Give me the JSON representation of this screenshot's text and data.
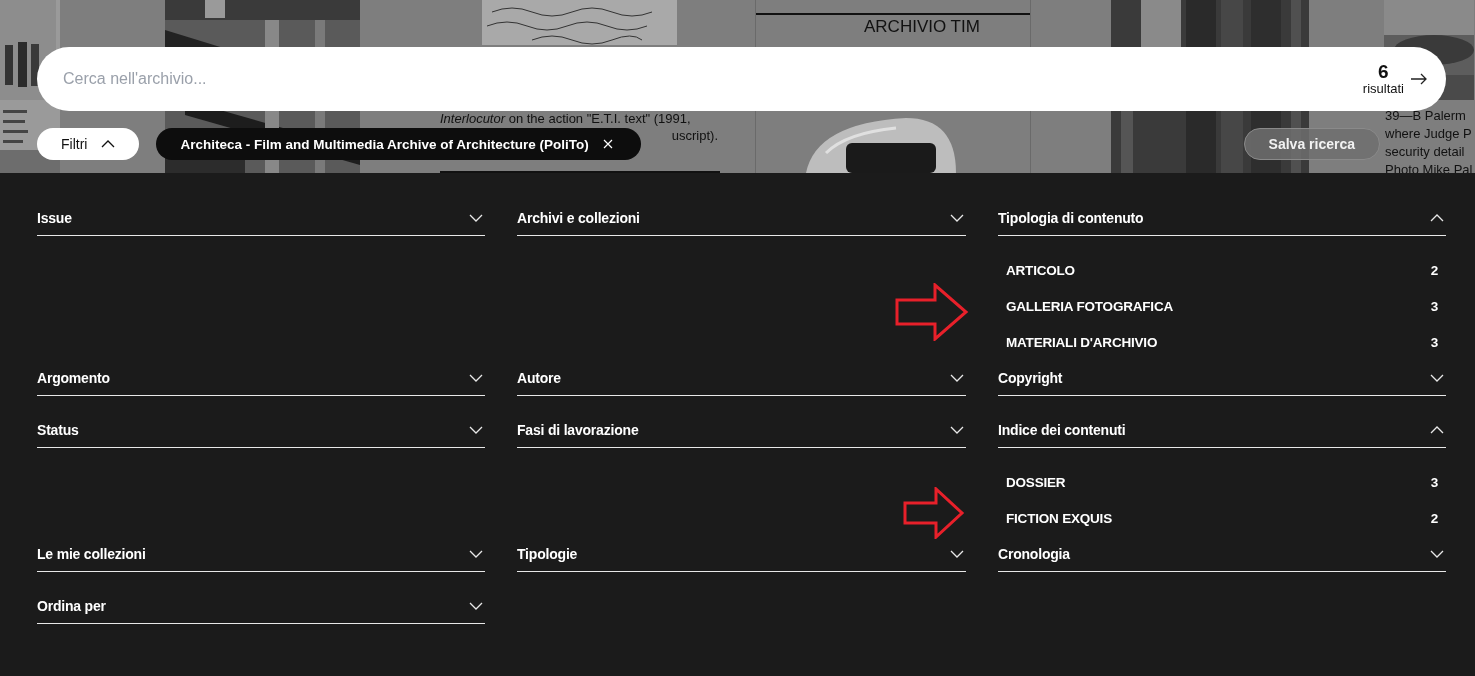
{
  "background": {
    "document_card": {
      "caption_lines": [
        "*Interlocutor* on the action \"E.T.I. text\" (1991,",
        "uscript)."
      ]
    },
    "issue_card": {
      "title": "ARCHIVIO TIM"
    },
    "photo_caption": {
      "lines": [
        "39—B    Palerm",
        "where Judge P",
        "security detail",
        "Photo Mike Pal"
      ]
    }
  },
  "search": {
    "placeholder": "Cerca nell'archivio...",
    "result_count": "6",
    "result_label": "risultati"
  },
  "filters_button": {
    "label": "Filtri",
    "expanded": true
  },
  "active_filters": [
    {
      "label": "Architeca - Film and Multimedia Archive of Architecture (PoliTo)"
    }
  ],
  "save_button": {
    "label": "Salva ricerca"
  },
  "filter_sections": [
    {
      "label": "Issue",
      "expanded": false
    },
    {
      "label": "Archivi e collezioni",
      "expanded": false
    },
    {
      "label": "Tipologia di contenuto",
      "expanded": true,
      "options": [
        {
          "label": "ARTICOLO",
          "count": "2"
        },
        {
          "label": "GALLERIA FOTOGRAFICA",
          "count": "3"
        },
        {
          "label": "MATERIALI D'ARCHIVIO",
          "count": "3"
        }
      ]
    },
    {
      "label": "Argomento",
      "expanded": false
    },
    {
      "label": "Autore",
      "expanded": false
    },
    {
      "label": "Copyright",
      "expanded": false
    },
    {
      "label": "Status",
      "expanded": false
    },
    {
      "label": "Fasi di lavorazione",
      "expanded": false
    },
    {
      "label": "Indice dei contenuti",
      "expanded": true,
      "options": [
        {
          "label": "DOSSIER",
          "count": "3"
        },
        {
          "label": "FICTION EXQUIS",
          "count": "2"
        }
      ]
    },
    {
      "label": "Le mie collezioni",
      "expanded": false
    },
    {
      "label": "Tipologie",
      "expanded": false
    },
    {
      "label": "Cronologia",
      "expanded": false
    },
    {
      "label": "Ordina per",
      "expanded": false
    }
  ]
}
